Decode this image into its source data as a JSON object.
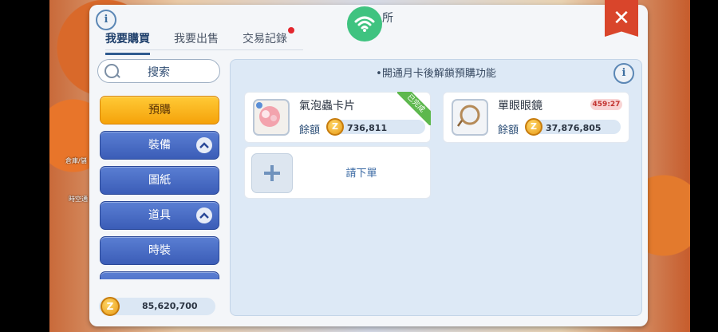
{
  "background": {
    "labels": [
      "倉庫/儲",
      "時空通"
    ]
  },
  "header": {
    "title_fragment": "所",
    "info_icon": "info-icon",
    "close_icon": "close-icon",
    "wifi_icon": "wifi-icon"
  },
  "tabs": [
    {
      "label": "我要購買",
      "active": true
    },
    {
      "label": "我要出售",
      "active": false
    },
    {
      "label": "交易記錄",
      "active": false,
      "badge": true
    }
  ],
  "search": {
    "label": "搜索"
  },
  "categories": [
    {
      "label": "預購",
      "active": true
    },
    {
      "label": "裝備",
      "expandable": true
    },
    {
      "label": "圖紙"
    },
    {
      "label": "道具",
      "expandable": true
    },
    {
      "label": "時裝"
    }
  ],
  "wallet": {
    "balance": "85,620,700"
  },
  "notice": "•開通月卡後解鎖預購功能",
  "listings": [
    {
      "name": "氣泡蟲卡片",
      "price_label": "餘額",
      "price": "736,811",
      "ribbon": "已完成"
    },
    {
      "name": "單眼眼鏡",
      "price_label": "餘額",
      "price": "37,876,805",
      "timer": "459:27"
    }
  ],
  "add_slot": {
    "label": "請下單"
  },
  "colors": {
    "accent": "#2e5a8f",
    "active_category": "#f5a20a",
    "category": "#3b5db7",
    "close": "#d9452b",
    "ribbon": "#5db84d",
    "badge": "#e3262e"
  }
}
